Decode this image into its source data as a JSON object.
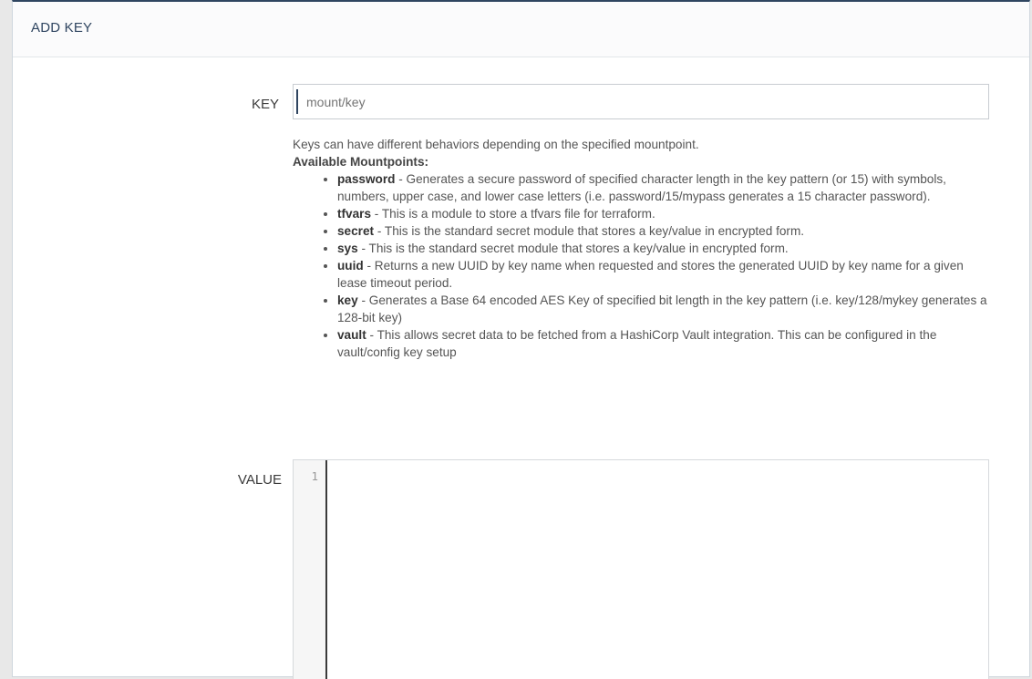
{
  "header": {
    "title": "ADD KEY"
  },
  "key": {
    "label": "KEY",
    "placeholder": "mount/key",
    "value": ""
  },
  "help": {
    "intro": "Keys can have different behaviors depending on the specified mountpoint.",
    "subheading": "Available Mountpoints:",
    "items": [
      {
        "name": "password",
        "desc": " - Generates a secure password of specified character length in the key pattern (or 15) with symbols, numbers, upper case, and lower case letters (i.e. password/15/mypass generates a 15 character password)."
      },
      {
        "name": "tfvars",
        "desc": " - This is a module to store a tfvars file for terraform."
      },
      {
        "name": "secret",
        "desc": " - This is the standard secret module that stores a key/value in encrypted form."
      },
      {
        "name": "sys",
        "desc": " - This is the standard secret module that stores a key/value in encrypted form."
      },
      {
        "name": "uuid",
        "desc": " - Returns a new UUID by key name when requested and stores the generated UUID by key name for a given lease timeout period."
      },
      {
        "name": "key",
        "desc": " - Generates a Base 64 encoded AES Key of specified bit length in the key pattern (i.e. key/128/mykey generates a 128-bit key)"
      },
      {
        "name": "vault",
        "desc": " - This allows secret data to be fetched from a HashiCorp Vault integration. This can be configured in the vault/config key setup"
      }
    ]
  },
  "value": {
    "label": "VALUE",
    "line_numbers": [
      "1"
    ],
    "content": ""
  }
}
